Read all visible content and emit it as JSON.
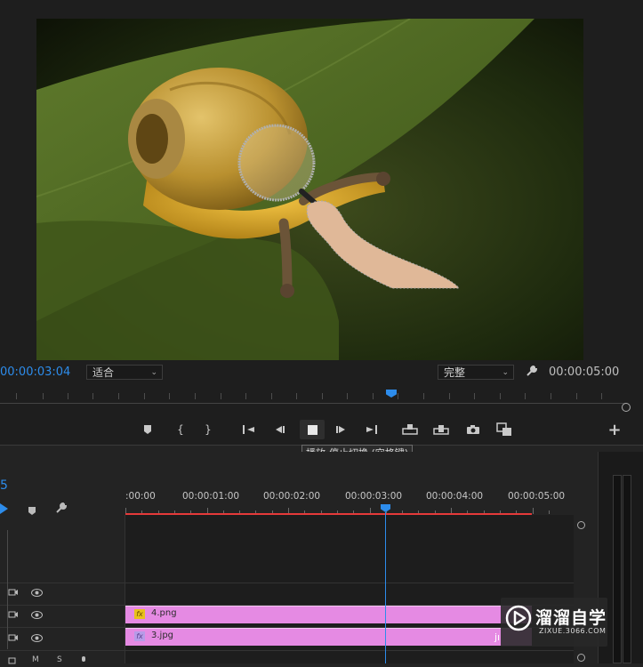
{
  "monitor": {
    "current_timecode": "00:00:03:04",
    "fit_dropdown": "适合",
    "quality_dropdown": "完整",
    "duration_timecode": "00:00:05:00",
    "tooltip": "播放-停止切换 (空格键)"
  },
  "controls": {
    "icons": [
      "marker-icon",
      "mark-in-icon",
      "mark-out-icon",
      "go-to-in-icon",
      "step-back-icon",
      "stop-icon",
      "step-forward-icon",
      "go-to-out-icon",
      "insert-icon",
      "overwrite-icon",
      "export-frame-icon",
      "comparison-view-icon",
      "add-button-icon"
    ]
  },
  "timeline": {
    "sequence_number": "5",
    "ruler_labels": [
      ":00:00",
      "00:00:01:00",
      "00:00:02:00",
      "00:00:03:00",
      "00:00:04:00",
      "00:00:05:00"
    ],
    "clips": [
      {
        "name": "4.png",
        "fx": "fx"
      },
      {
        "name": "3.jpg",
        "fx": "fx"
      }
    ]
  },
  "watermark": {
    "title": "溜溜自学",
    "subtitle": "ZIXUE.3066.COM",
    "clip_overlay_text": "jı"
  },
  "colors": {
    "accent_blue": "#2d8ceb",
    "clip_pink": "#e58ae3",
    "work_area_red": "#e53a3a"
  }
}
